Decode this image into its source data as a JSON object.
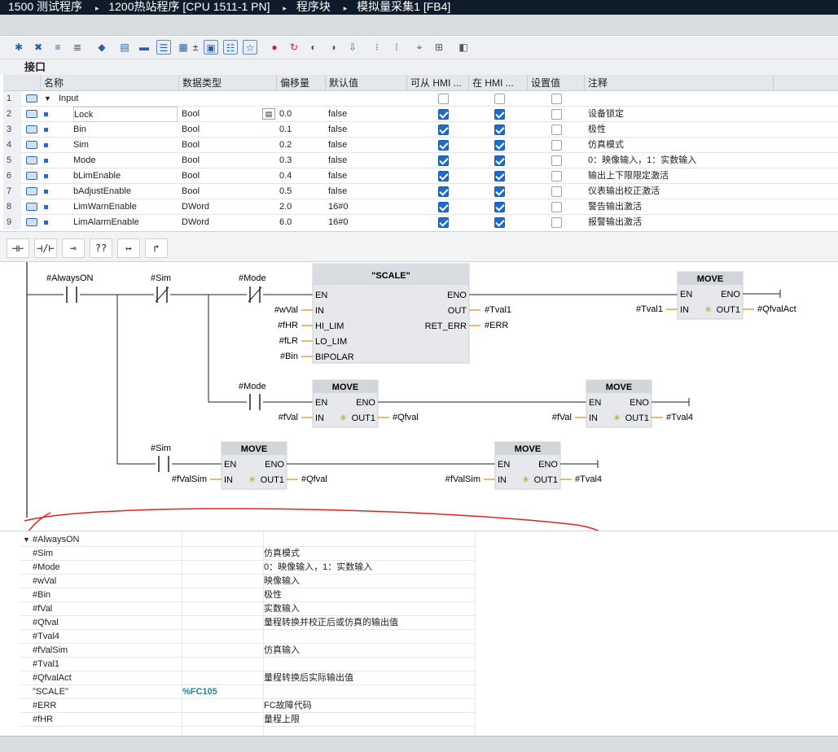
{
  "titlebar": {
    "crumbs": [
      "1500 测试程序",
      "1200热站程序 [CPU 1511-1 PN]",
      "程序块",
      "模拟量采集1 [FB4]"
    ]
  },
  "interface_label": "接口",
  "grid": {
    "headers": [
      "名称",
      "数据类型",
      "偏移量",
      "默认值",
      "可从 HMI ...",
      "在 HMI ...",
      "设置值",
      "注释"
    ],
    "section": {
      "num": "1",
      "name": "Input"
    },
    "rows": [
      {
        "num": "2",
        "name": "Lock",
        "type": "Bool",
        "offset": "0.0",
        "default": "false",
        "hmi1": true,
        "hmi2": true,
        "set": false,
        "comment": "设备锁定"
      },
      {
        "num": "3",
        "name": "Bin",
        "type": "Bool",
        "offset": "0.1",
        "default": "false",
        "hmi1": true,
        "hmi2": true,
        "set": false,
        "comment": "极性"
      },
      {
        "num": "4",
        "name": "Sim",
        "type": "Bool",
        "offset": "0.2",
        "default": "false",
        "hmi1": true,
        "hmi2": true,
        "set": false,
        "comment": "仿真模式"
      },
      {
        "num": "5",
        "name": "Mode",
        "type": "Bool",
        "offset": "0.3",
        "default": "false",
        "hmi1": true,
        "hmi2": true,
        "set": false,
        "comment": "0：映像输入，1：实数输入"
      },
      {
        "num": "6",
        "name": "bLimEnable",
        "type": "Bool",
        "offset": "0.4",
        "default": "false",
        "hmi1": true,
        "hmi2": true,
        "set": false,
        "comment": "输出上下限限定激活"
      },
      {
        "num": "7",
        "name": "bAdjustEnable",
        "type": "Bool",
        "offset": "0.5",
        "default": "false",
        "hmi1": true,
        "hmi2": true,
        "set": false,
        "comment": "仪表输出校正激活"
      },
      {
        "num": "8",
        "name": "LimWarnEnable",
        "type": "DWord",
        "offset": "2.0",
        "default": "16#0",
        "hmi1": true,
        "hmi2": true,
        "set": false,
        "comment": "警告输出激活"
      },
      {
        "num": "9",
        "name": "LimAlarmEnable",
        "type": "DWord",
        "offset": "6.0",
        "default": "16#0",
        "hmi1": true,
        "hmi2": true,
        "set": false,
        "comment": "报警输出激活"
      }
    ]
  },
  "ladder_toolbar": [
    "⊣⊢",
    "⊣/⊢",
    "⊸",
    "??",
    "↦",
    "↱"
  ],
  "ladder": {
    "contacts": {
      "always_on": "#AlwaysON",
      "sim": "#Sim",
      "mode1": "#Mode",
      "mode2": "#Mode",
      "sim2": "#Sim"
    },
    "scale": {
      "name": "\"SCALE\"",
      "en": "EN",
      "eno": "ENO",
      "in": "IN",
      "out": "OUT",
      "hi": "HI_LIM",
      "lo": "LO_LIM",
      "ret": "RET_ERR",
      "bipolar": "BIPOLAR",
      "in_var": "#wVal",
      "hi_var": "#fHR",
      "lo_var": "#fLR",
      "bip_var": "#Bin",
      "out_var": "#Tval1",
      "ret_var": "#ERR"
    },
    "move": {
      "title": "MOVE",
      "en": "EN",
      "eno": "ENO",
      "in": "IN",
      "out": "OUT1"
    },
    "move1": {
      "in": "#Tval1",
      "out": "#QfvalAct"
    },
    "move2": {
      "in": "#fVal",
      "out": "#Qfval"
    },
    "move3": {
      "in": "#fVal",
      "out": "#Tval4"
    },
    "move4": {
      "in": "#fValSim",
      "out": "#Qfval"
    },
    "move5": {
      "in": "#fValSim",
      "out": "#Tval4"
    }
  },
  "xref": {
    "group": "#AlwaysON",
    "rows": [
      {
        "name": "#Sim",
        "addr": "",
        "comment": "仿真模式"
      },
      {
        "name": "#Mode",
        "addr": "",
        "comment": "0：映像输入，1：实数输入"
      },
      {
        "name": "#wVal",
        "addr": "",
        "comment": "映像输入"
      },
      {
        "name": "#Bin",
        "addr": "",
        "comment": "极性"
      },
      {
        "name": "#fVal",
        "addr": "",
        "comment": "实数输入"
      },
      {
        "name": "#Qfval",
        "addr": "",
        "comment": "量程转换并校正后或仿真的输出值"
      },
      {
        "name": "#Tval4",
        "addr": "",
        "comment": ""
      },
      {
        "name": "#fValSim",
        "addr": "",
        "comment": "仿真输入"
      },
      {
        "name": "#Tval1",
        "addr": "",
        "comment": ""
      },
      {
        "name": "#QfvalAct",
        "addr": "",
        "comment": "量程转换后实际输出值"
      },
      {
        "name": "\"SCALE\"",
        "addr": "%FC105",
        "comment": ""
      },
      {
        "name": "#ERR",
        "addr": "",
        "comment": "FC故障代码"
      },
      {
        "name": "#fHR",
        "addr": "",
        "comment": "量程上限"
      }
    ]
  },
  "colors": {
    "accent": "#1f6bcb",
    "annotation": "#e0231b",
    "title_bg": "#0e1b2a"
  }
}
